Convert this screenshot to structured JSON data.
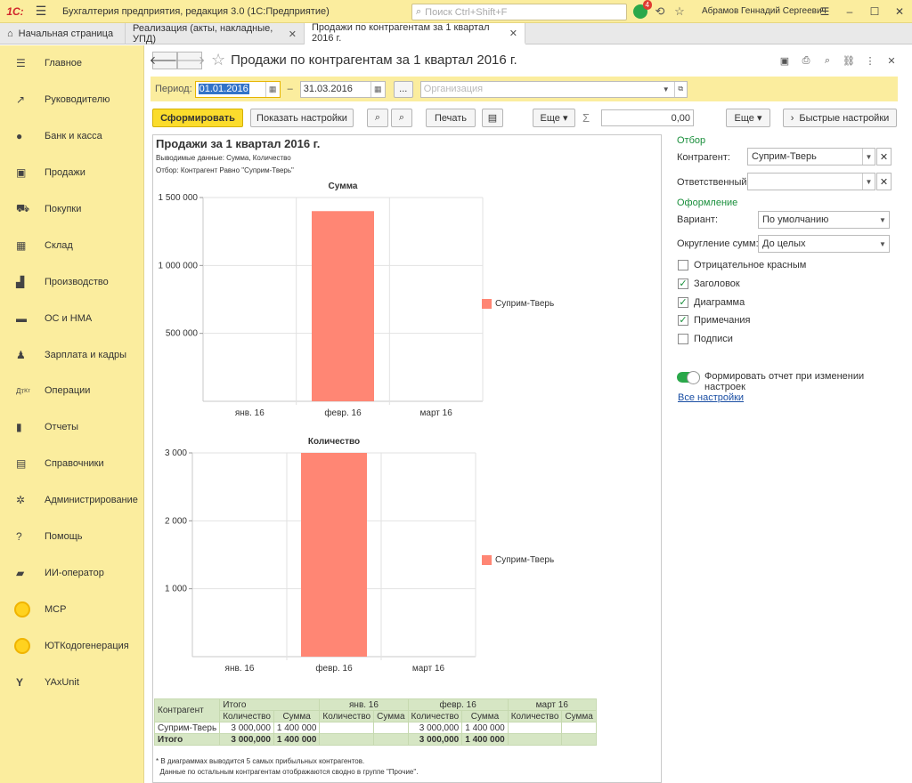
{
  "titlebar": {
    "logo": "1С:",
    "app_title": "Бухгалтерия предприятия, редакция 3.0  (1С:Предприятие)",
    "search_placeholder": "Поиск Ctrl+Shift+F",
    "notification_count": "4",
    "username": "Абрамов Геннадий Сергеевич"
  },
  "tabs": [
    {
      "label": "Начальная страница"
    },
    {
      "label": "Реализация (акты, накладные, УПД)"
    },
    {
      "label": "Продажи по контрагентам за 1 квартал 2016 г."
    }
  ],
  "sidebar": {
    "items": [
      {
        "label": "Главное",
        "icon": "menu-icon"
      },
      {
        "label": "Руководителю",
        "icon": "trend-icon"
      },
      {
        "label": "Банк и касса",
        "icon": "bank-icon"
      },
      {
        "label": "Продажи",
        "icon": "sales-icon"
      },
      {
        "label": "Покупки",
        "icon": "cart-icon"
      },
      {
        "label": "Склад",
        "icon": "warehouse-icon"
      },
      {
        "label": "Производство",
        "icon": "factory-icon"
      },
      {
        "label": "ОС и НМА",
        "icon": "truck-icon"
      },
      {
        "label": "Зарплата и кадры",
        "icon": "person-icon"
      },
      {
        "label": "Операции",
        "icon": "dtkt-icon"
      },
      {
        "label": "Отчеты",
        "icon": "report-icon"
      },
      {
        "label": "Справочники",
        "icon": "book-icon"
      },
      {
        "label": "Администрирование",
        "icon": "gear-icon"
      },
      {
        "label": "Помощь",
        "icon": "help-icon"
      },
      {
        "label": "ИИ-оператор",
        "icon": "chat-icon"
      },
      {
        "label": "МСР",
        "icon": "circle-icon"
      },
      {
        "label": "ЮТКодогенерация",
        "icon": "circle-icon"
      },
      {
        "label": "YAxUnit",
        "icon": "yax-icon"
      }
    ]
  },
  "page": {
    "title": "Продажи по контрагентам за 1 квартал 2016 г.",
    "period_label": "Период:",
    "period_from": "01.01.2016",
    "period_dash": "–",
    "period_to": "31.03.2016",
    "ellipsis": "...",
    "org_placeholder": "Организация"
  },
  "toolbar": {
    "generate": "Сформировать",
    "show_settings": "Показать настройки",
    "print": "Печать",
    "more1": "Еще ▾",
    "sigma": "Σ",
    "sum_value": "0,00",
    "more2": "Еще ▾",
    "quick_settings": "Быстрые настройки"
  },
  "report": {
    "title": "Продажи за 1 квартал 2016 г.",
    "output_note": "Выводимые данные: Сумма, Количество",
    "filter_note": "Отбор: Контрагент Равно \"Суприм-Тверь\"",
    "footnote1": "* В диаграммах выводится 5 самых прибыльных контрагентов.",
    "footnote2": "  Данные по остальным контрагентам отображаются сводно в группе \"Прочие\"."
  },
  "chart_data": [
    {
      "type": "bar",
      "title": "Сумма",
      "categories": [
        "янв. 16",
        "февр. 16",
        "март 16"
      ],
      "series": [
        {
          "name": "Суприм-Тверь",
          "values": [
            0,
            1400000,
            0
          ]
        }
      ],
      "ylim": [
        0,
        1500000
      ],
      "yticks": [
        "500 000",
        "1 000 000",
        "1 500 000"
      ],
      "ytick_values": [
        500000,
        1000000,
        1500000
      ],
      "color": "#ff8674",
      "grid": true,
      "legend": "right"
    },
    {
      "type": "bar",
      "title": "Количество",
      "categories": [
        "янв. 16",
        "февр. 16",
        "март 16"
      ],
      "series": [
        {
          "name": "Суприм-Тверь",
          "values": [
            0,
            3000,
            0
          ]
        }
      ],
      "ylim": [
        0,
        3000
      ],
      "yticks": [
        "1 000",
        "2 000",
        "3 000"
      ],
      "ytick_values": [
        1000,
        2000,
        3000
      ],
      "color": "#ff8674",
      "grid": true,
      "legend": "right"
    }
  ],
  "table": {
    "h_kontragent": "Контрагент",
    "h_itogo": "Итого",
    "h_jan": "янв. 16",
    "h_feb": "февр. 16",
    "h_mar": "март 16",
    "h_qty": "Количество",
    "h_sum": "Сумма",
    "row_name": "Суприм-Тверь",
    "row_total_qty": "3 000,000",
    "row_total_sum": "1 400 000",
    "row_feb_qty": "3 000,000",
    "row_feb_sum": "1 400 000",
    "total_label": "Итого",
    "total_qty": "3 000,000",
    "total_sum": "1 400 000",
    "total_feb_qty": "3 000,000",
    "total_feb_sum": "1 400 000"
  },
  "settings": {
    "filter_section": "Отбор",
    "kontragent_label": "Контрагент:",
    "kontragent_value": "Суприм-Тверь",
    "responsible_label": "Ответственный:",
    "responsible_value": "",
    "design_section": "Оформление",
    "variant_label": "Вариант:",
    "variant_value": "По умолчанию",
    "rounding_label": "Округление сумм:",
    "rounding_value": "До целых",
    "neg_red": "Отрицательное красным",
    "header": "Заголовок",
    "diagram": "Диаграмма",
    "notes": "Примечания",
    "signatures": "Подписи",
    "auto_generate": "Формировать отчет при изменении настроек",
    "all_settings": "Все настройки"
  }
}
